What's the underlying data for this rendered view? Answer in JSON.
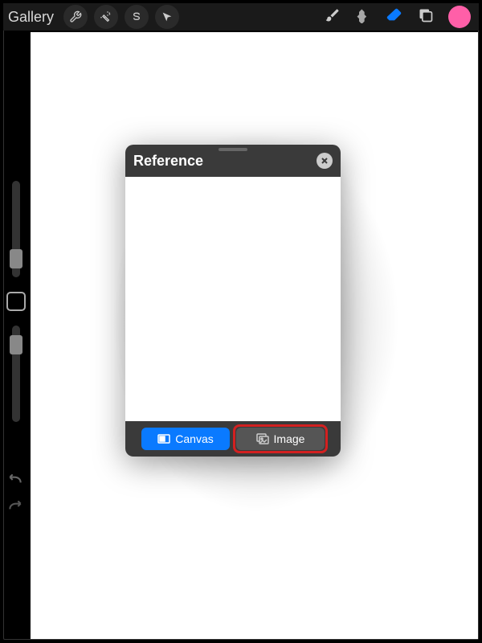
{
  "toolbar": {
    "gallery_label": "Gallery"
  },
  "colors": {
    "active_color": "#ff5fa8",
    "eraser_icon": "#0a7aff"
  },
  "reference_panel": {
    "title": "Reference",
    "footer": {
      "canvas_label": "Canvas",
      "image_label": "Image"
    }
  }
}
